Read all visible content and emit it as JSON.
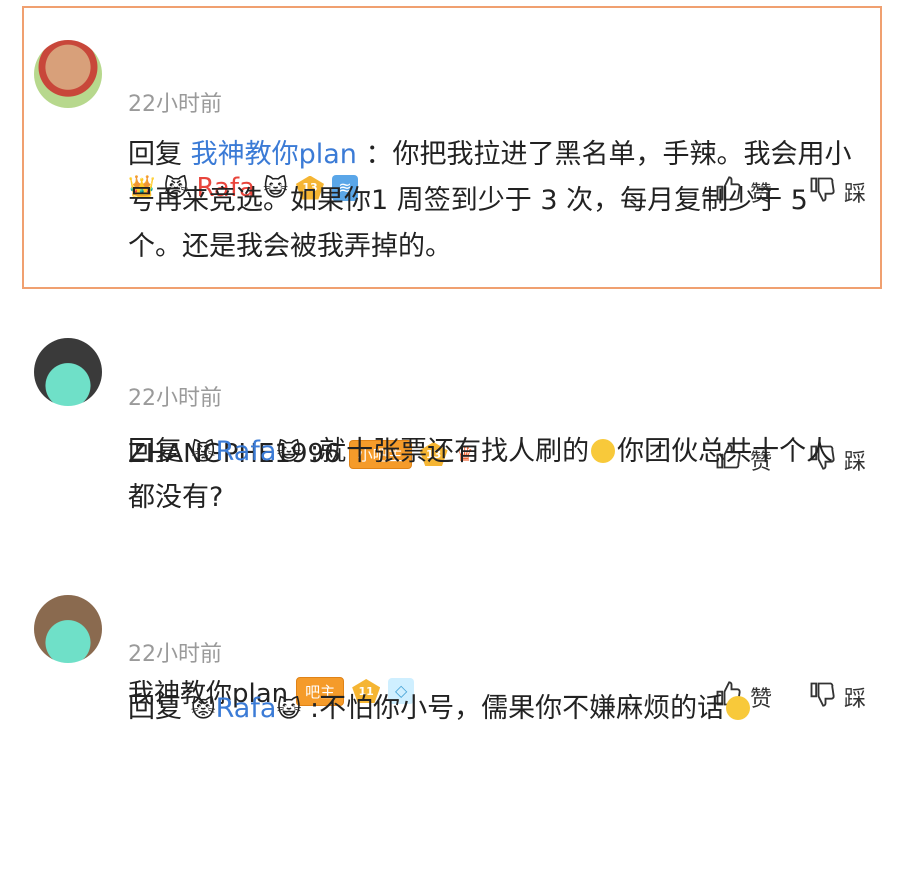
{
  "comments": [
    {
      "username": "Rafa",
      "crown_icon": "crown-icon",
      "cat_icon": "cat-face-icon",
      "level": "13",
      "time": "22小时前",
      "like_label": "赞",
      "dislike_label": "踩",
      "reply_prefix": "回复",
      "mention": "我神教你plan",
      "text": "：你把我拉进了黑名单，手辣。我会用小号再来竞选。如果你1 周签到少于 3 次，每月复制少于 5 个。还是我会被我弄掉的。"
    },
    {
      "username": "ZHANGPHE1996",
      "role": "小吧主",
      "level": "13",
      "time": "22小时前",
      "like_label": "赞",
      "dislike_label": "踩",
      "reply_prefix": "回复",
      "mention": "Rafa",
      "text": ":就十张票还有找人刷的",
      "text2": "你团伙总共十个人都没有?"
    },
    {
      "username": "我神教你plan",
      "role": "吧主",
      "level": "11",
      "time": "22小时前",
      "like_label": "赞",
      "dislike_label": "踩",
      "reply_prefix": "回复",
      "mention": "Rafa",
      "text": ":不怕你小号，儒果你不嫌麻烦的话"
    }
  ],
  "colors": {
    "accent_red": "#e8453c",
    "link_blue": "#3b7bd6",
    "role_orange": "#f59b2a",
    "highlight_border": "#f0a070"
  }
}
